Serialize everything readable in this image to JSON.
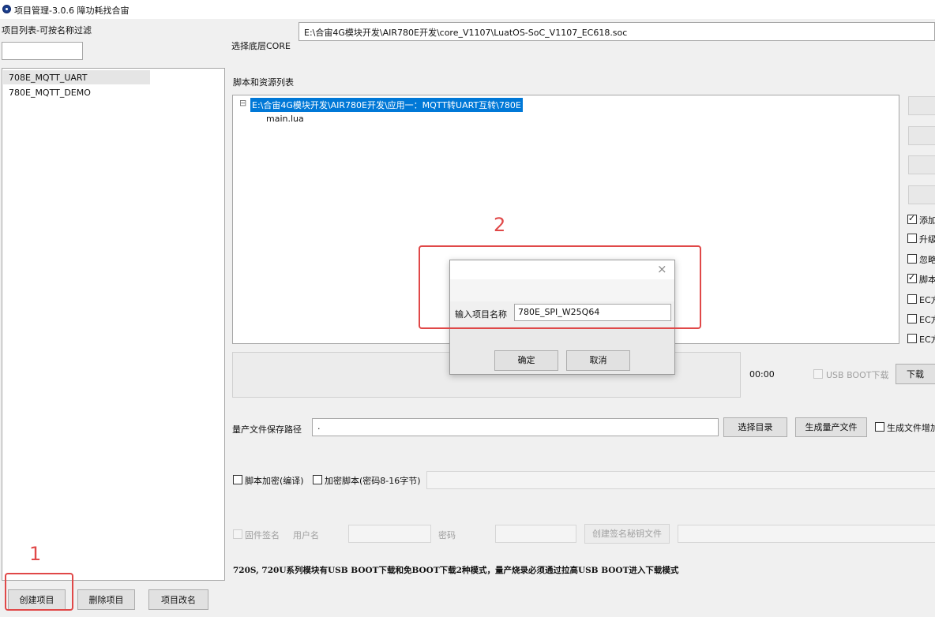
{
  "window": {
    "title": "项目管理-3.0.6 障功耗找合宙"
  },
  "left_panel": {
    "filter_label": "项目列表-可按名称过滤",
    "filter_value": "",
    "projects": [
      "708E_MQTT_UART",
      "780E_MQTT_DEMO"
    ],
    "buttons": {
      "create": "创建项目",
      "delete": "删除项目",
      "rename": "项目改名"
    }
  },
  "core": {
    "label": "选择底层CORE",
    "path": "E:\\合宙4G模块开发\\AIR780E开发\\core_V1107\\LuatOS-SoC_V1107_EC618.soc"
  },
  "scripts": {
    "label": "脚本和资源列表",
    "root_expand": "⊟",
    "root_path": "E:\\合宙4G模块开发\\AIR780E开发\\应用一：MQTT转UART互转\\780E",
    "files": [
      "main.lua"
    ]
  },
  "right_options": [
    {
      "label": "添加",
      "checked": true
    },
    {
      "label": "升级",
      "checked": false
    },
    {
      "label": "忽略",
      "checked": false
    },
    {
      "label": "脚本",
      "checked": true
    },
    {
      "label": "EC方",
      "checked": false
    },
    {
      "label": "EC方",
      "checked": false
    },
    {
      "label": "EC方",
      "checked": false
    }
  ],
  "download": {
    "time": "00:00",
    "usb_boot_label": "USB BOOT下载",
    "download_button": "下载"
  },
  "mass_production": {
    "label": "量产文件保存路径",
    "path": ".",
    "choose_dir_button": "选择目录",
    "generate_button": "生成量产文件",
    "generate_option": "生成文件增加"
  },
  "encryption": {
    "script_encrypt": "脚本加密(编译)",
    "encrypt_script": "加密脚本(密码8-16字节)"
  },
  "signature": {
    "firmware_sign": "固件签名",
    "username_label": "用户名",
    "password_label": "密码",
    "create_key_button": "创建签名秘钥文件"
  },
  "notice": "720S, 720U系列模块有USB BOOT下载和免BOOT下载2种模式，量产烧录必须通过拉高USB BOOT进入下载模式",
  "dialog": {
    "close_icon": "×",
    "input_label": "输入项目名称",
    "input_value": "780E_SPI_W25Q64",
    "ok_button": "确定",
    "cancel_button": "取消"
  },
  "annotations": {
    "marker_1": "1",
    "marker_2": "2"
  },
  "colors": {
    "annotation_red": "#e04848",
    "selection_blue": "#0078d7"
  }
}
